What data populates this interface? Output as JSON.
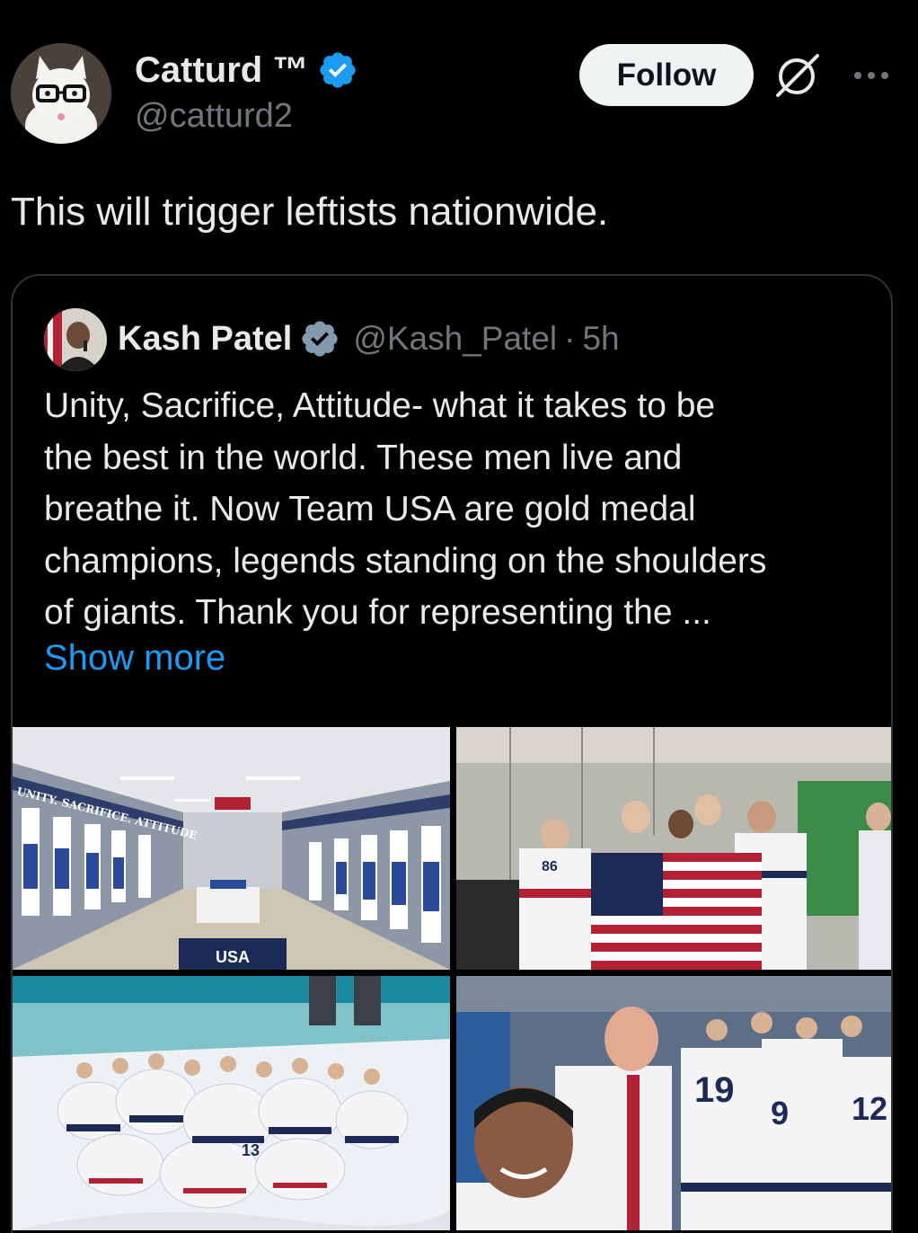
{
  "tweet": {
    "author_name": "Catturd ™",
    "author_handle": "@catturd2",
    "follow_label": "Follow",
    "text": "This will trigger leftists nationwide.",
    "icons": {
      "verified": "verified-badge-icon",
      "grok": "grok-icon",
      "more": "more-options-icon"
    }
  },
  "quote": {
    "author_name": "Kash Patel",
    "author_handle": "@Kash_Patel",
    "separator": "·",
    "time": "5h",
    "lines": [
      "Unity, Sacrifice, Attitude- what it takes to be",
      "the best in the world. These men live and",
      "breathe it. Now Team USA are gold medal",
      "champions, legends standing on the shoulders",
      "of giants.  Thank you for representing the ..."
    ],
    "show_more": "Show more",
    "images": {
      "locker_room_signage": "UNITY. SACRIFICE. ATTITUDE",
      "locker_room_floor": "USA",
      "jersey_numbers": [
        "86",
        "13",
        "19",
        "9",
        "12"
      ]
    }
  },
  "colors": {
    "background": "#000000",
    "text": "#e7e9ea",
    "muted": "#71767b",
    "link": "#1d9bf0",
    "verified": "#1d9bf0",
    "border": "#2f3336",
    "follow_bg": "#eff3f4"
  }
}
